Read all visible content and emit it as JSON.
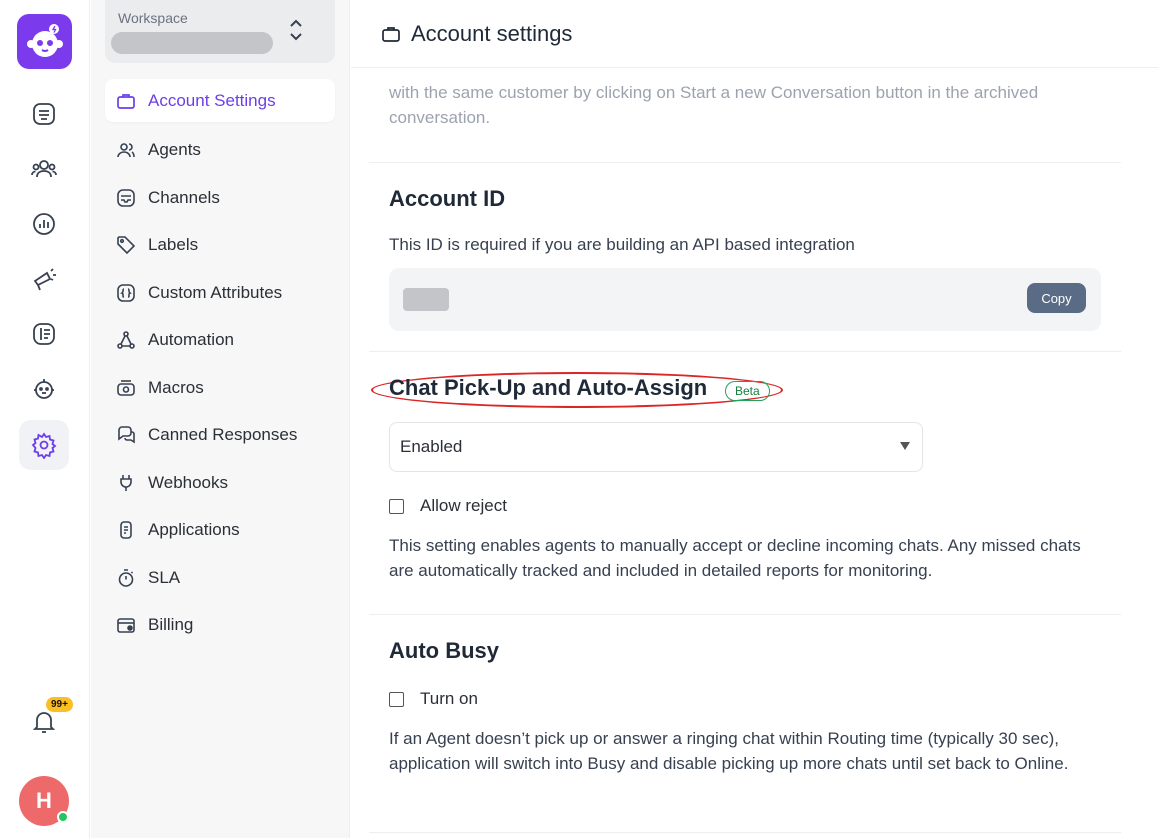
{
  "rail": {
    "items": [
      {
        "icon": "conversations-icon"
      },
      {
        "icon": "contacts-icon"
      },
      {
        "icon": "reports-icon"
      },
      {
        "icon": "campaigns-icon"
      },
      {
        "icon": "help-center-icon"
      },
      {
        "icon": "bot-icon"
      },
      {
        "icon": "settings-icon",
        "active": true
      }
    ],
    "notifications_badge": "99+",
    "avatar_initial": "H"
  },
  "sidebar": {
    "workspace_label": "Workspace",
    "items": [
      {
        "label": "Account Settings",
        "icon": "briefcase-icon",
        "active": true
      },
      {
        "label": "Agents",
        "icon": "users-icon"
      },
      {
        "label": "Channels",
        "icon": "inbox-icon"
      },
      {
        "label": "Labels",
        "icon": "tag-icon"
      },
      {
        "label": "Custom Attributes",
        "icon": "code-brackets-icon"
      },
      {
        "label": "Automation",
        "icon": "automation-icon"
      },
      {
        "label": "Macros",
        "icon": "macros-icon"
      },
      {
        "label": "Canned Responses",
        "icon": "chat-bubbles-icon"
      },
      {
        "label": "Webhooks",
        "icon": "webhook-icon"
      },
      {
        "label": "Applications",
        "icon": "applications-icon"
      },
      {
        "label": "SLA",
        "icon": "stopwatch-icon"
      },
      {
        "label": "Billing",
        "icon": "wallet-icon"
      }
    ]
  },
  "header": {
    "title": "Account settings"
  },
  "main": {
    "intro_text": "with the same customer by clicking on Start a new Conversation button in the archived conversation.",
    "account_id": {
      "title": "Account ID",
      "description": "This ID is required if you are building an API based integration",
      "copy_label": "Copy"
    },
    "pickup": {
      "title": "Chat Pick-Up and Auto-Assign",
      "badge": "Beta",
      "select_value": "Enabled",
      "checkbox_label": "Allow reject",
      "description": "This setting enables agents to manually accept or decline incoming chats. Any missed chats are automatically tracked and included in detailed reports for monitoring."
    },
    "auto_busy": {
      "title": "Auto Busy",
      "checkbox_label": "Turn on",
      "description": "If an Agent doesn’t pick up or answer a ringing chat within Routing time (typically 30 sec), application will switch into Busy and disable picking up more chats until set back to Online."
    }
  },
  "colors": {
    "brand": "#7c3aed",
    "active_nav": "#6d3ee8",
    "copy_button": "#5a6b86",
    "beta_badge": "#15803d",
    "highlight": "#dc2626"
  }
}
